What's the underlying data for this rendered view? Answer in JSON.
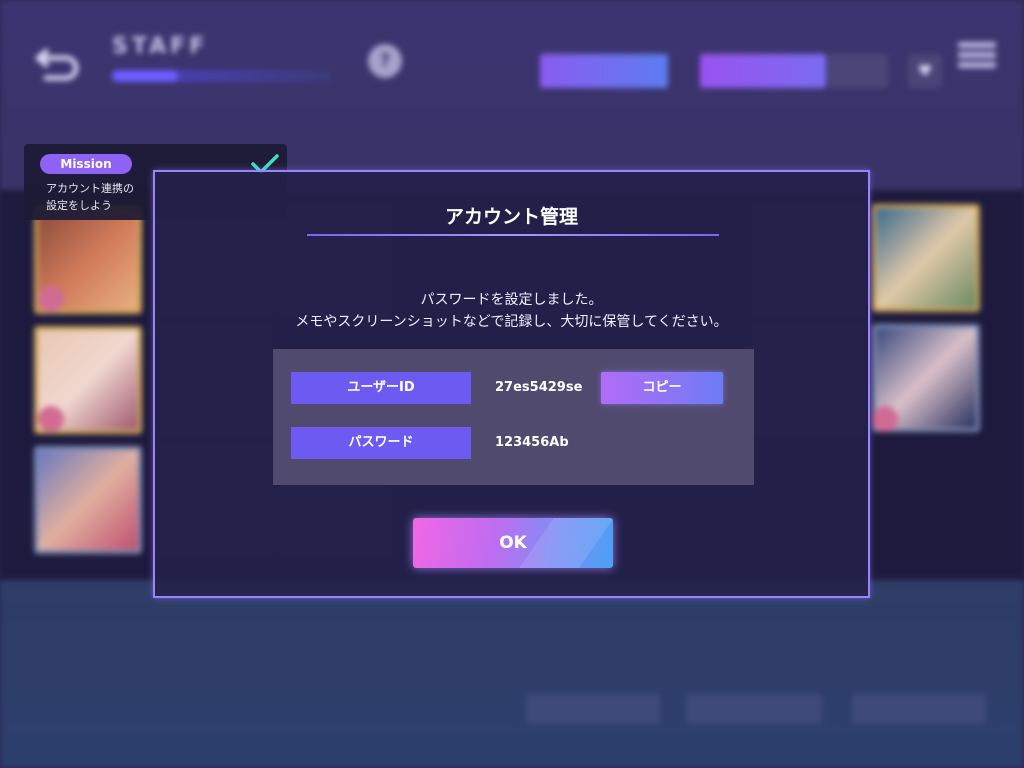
{
  "background": {
    "header": {
      "title": "STAFF",
      "staff_progress_fraction": 0.3,
      "help_glyph": "?",
      "button_a_label": "",
      "button_b_label": "",
      "button_c_label": "",
      "heart_glyph": "♥"
    },
    "footer": {
      "button_1_label": "",
      "button_2_label": "",
      "button_3_label": ""
    }
  },
  "mission": {
    "pill_label": "Mission",
    "text_line1": "アカウント連携の",
    "text_line2": "設定をしよう",
    "completed": true
  },
  "dialog": {
    "title": "アカウント管理",
    "message_line1": "パスワードを設定しました。",
    "message_line2": "メモやスクリーンショットなどで記録し、大切に保管してください。",
    "user_id_label": "ユーザーID",
    "user_id_value": "27es5429se",
    "password_label": "パスワード",
    "password_value": "123456Ab",
    "copy_label": "コピー",
    "ok_label": "OK"
  },
  "colors": {
    "accent_purple": "#6d5af0",
    "dialog_border": "#9b82ff",
    "mission_pill": "#8d62f5",
    "check_color": "#3fe0c0"
  },
  "icons": {
    "back": "back-arrow-icon",
    "help": "help-icon",
    "menu": "hamburger-menu-icon",
    "heart": "heart-icon",
    "check": "checkmark-icon"
  }
}
